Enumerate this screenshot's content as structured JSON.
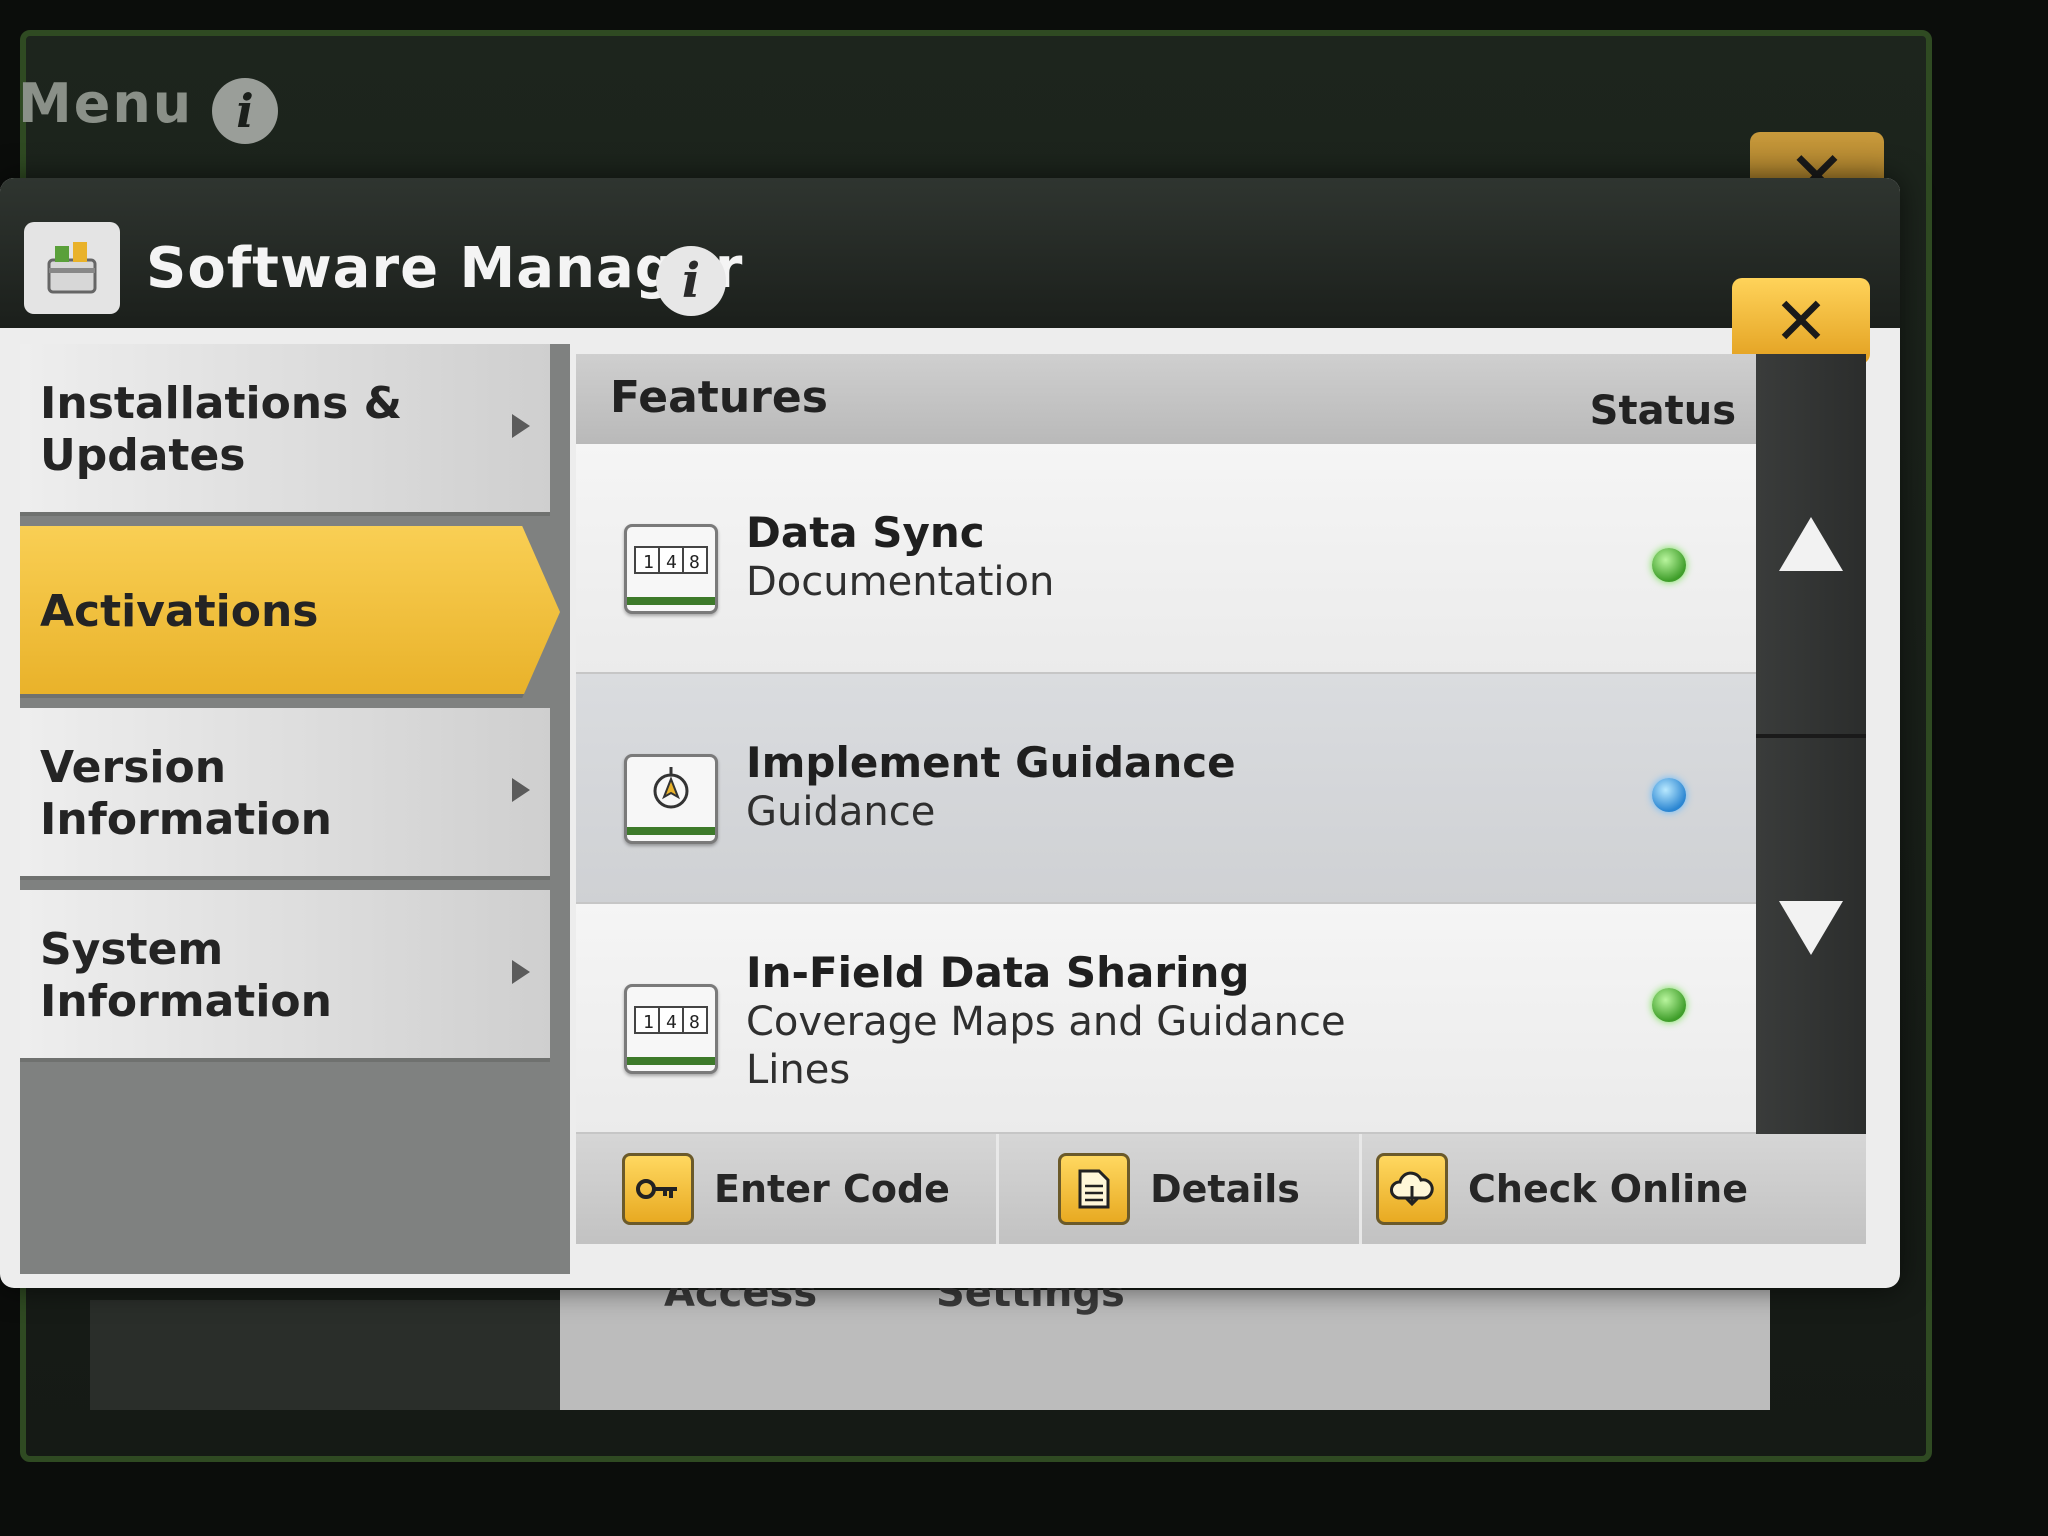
{
  "background_screen": {
    "menu_title": "Menu",
    "close_label": "✕",
    "bottom_labels": [
      "Access",
      "Settings"
    ]
  },
  "dialog": {
    "title": "Software Manager",
    "close_label": "✕",
    "app_icon": "software-manager-icon"
  },
  "sidebar": {
    "items": [
      {
        "label": "Installations &\nUpdates",
        "active": false,
        "has_arrow": true
      },
      {
        "label": "Activations",
        "active": true,
        "has_arrow": false
      },
      {
        "label": "Version\nInformation",
        "active": false,
        "has_arrow": true
      },
      {
        "label": "System\nInformation",
        "active": false,
        "has_arrow": true
      }
    ]
  },
  "features": {
    "header_title": "Features",
    "header_status": "Status",
    "rows": [
      {
        "name": "Data Sync",
        "category": "Documentation",
        "icon": "activation-counter-icon",
        "status_color": "#4caf2f"
      },
      {
        "name": "Implement Guidance",
        "category": "Guidance",
        "icon": "guidance-icon",
        "status_color": "#2b86d2"
      },
      {
        "name": "In-Field Data Sharing",
        "category": "Coverage Maps and Guidance Lines",
        "icon": "activation-counter-icon",
        "status_color": "#4caf2f"
      }
    ]
  },
  "footer": {
    "enter_code": "Enter Code",
    "details": "Details",
    "check_online": "Check Online"
  },
  "colors": {
    "accent_yellow": "#f2c440",
    "status_green": "#4caf2f",
    "status_blue": "#2b86d2"
  }
}
